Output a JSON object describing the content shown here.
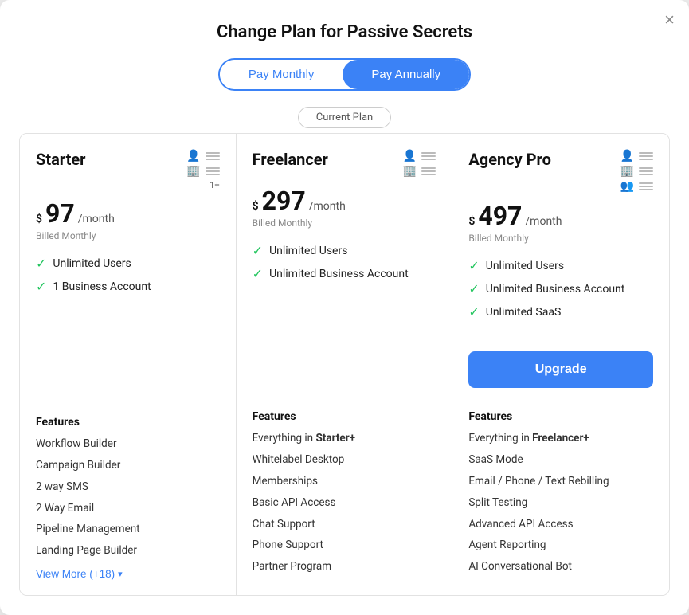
{
  "modal": {
    "title": "Change Plan for Passive Secrets",
    "close_label": "×"
  },
  "toggle": {
    "monthly_label": "Pay Monthly",
    "annually_label": "Pay Annually",
    "active": "monthly"
  },
  "current_plan_badge": "Current Plan",
  "plans": [
    {
      "id": "starter",
      "name": "Starter",
      "price_symbol": "$",
      "price": "97",
      "price_period": "/month",
      "billed": "Billed Monthly",
      "is_current": false,
      "upgrade_label": null,
      "included": [
        "Unlimited Users",
        "1 Business Account"
      ],
      "features_label": "Features",
      "features": [
        "Workflow Builder",
        "Campaign Builder",
        "2 way SMS",
        "2 Way Email",
        "Pipeline Management",
        "Landing Page Builder"
      ],
      "view_more_label": "View More (+18)",
      "view_more_icon": "▾"
    },
    {
      "id": "freelancer",
      "name": "Freelancer",
      "price_symbol": "$",
      "price": "297",
      "price_period": "/month",
      "billed": "Billed Monthly",
      "is_current": true,
      "upgrade_label": null,
      "included": [
        "Unlimited Users",
        "Unlimited Business Account"
      ],
      "features_label": "Features",
      "features": [
        "Everything in Starter+",
        "Whitelabel Desktop",
        "Memberships",
        "Basic API Access",
        "Chat Support",
        "Phone Support",
        "Partner Program"
      ],
      "features_bold": [
        "Starter+"
      ]
    },
    {
      "id": "agency-pro",
      "name": "Agency Pro",
      "price_symbol": "$",
      "price": "497",
      "price_period": "/month",
      "billed": "Billed Monthly",
      "is_current": false,
      "upgrade_label": "Upgrade",
      "included": [
        "Unlimited Users",
        "Unlimited Business Account",
        "Unlimited SaaS"
      ],
      "features_label": "Features",
      "features": [
        "Everything in Freelancer+",
        "SaaS Mode",
        "Email / Phone / Text Rebilling",
        "Split Testing",
        "Advanced API Access",
        "Agent Reporting",
        "AI Conversational Bot"
      ],
      "features_bold": [
        "Freelancer+"
      ]
    }
  ]
}
